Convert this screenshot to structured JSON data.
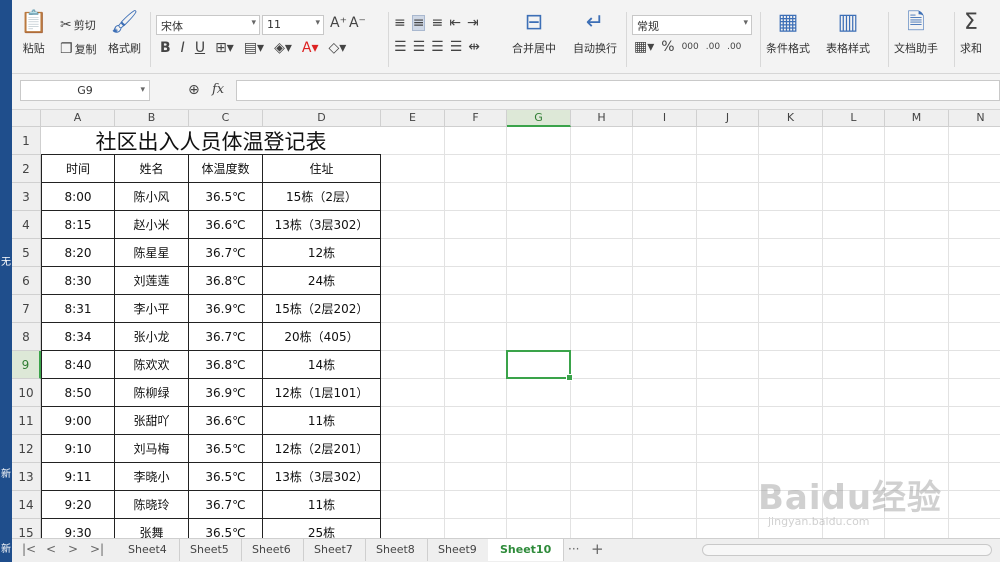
{
  "sidebar": {
    "text1": "无",
    "text2": "新",
    "text3": "新"
  },
  "ribbon": {
    "paste": "粘贴",
    "cut": "剪切",
    "copy": "复制",
    "format_painter": "格式刷",
    "font_name": "宋体",
    "font_size": "11",
    "bold": "B",
    "italic": "I",
    "underline": "U",
    "merge_center": "合并居中",
    "auto_wrap": "自动换行",
    "number_format": "常规",
    "percent": "%",
    "thousands": "000",
    "inc_decimal": ".00",
    "dec_decimal": ".00",
    "conditional_format": "条件格式",
    "table_style": "表格样式",
    "doc_assistant": "文档助手",
    "sum": "求和",
    "sum_symbol": "Σ"
  },
  "formula_bar": {
    "name_box": "G9",
    "fx": "fx",
    "formula": ""
  },
  "columns": [
    "A",
    "B",
    "C",
    "D",
    "E",
    "F",
    "G",
    "H",
    "I",
    "J",
    "K",
    "L",
    "M",
    "N"
  ],
  "rows": [
    "1",
    "2",
    "3",
    "4",
    "5",
    "6",
    "7",
    "8",
    "9",
    "10",
    "11",
    "12",
    "13",
    "14",
    "15"
  ],
  "table": {
    "title": "社区出入人员体温登记表",
    "headers": [
      "时间",
      "姓名",
      "体温度数",
      "住址"
    ],
    "rows": [
      [
        "8:00",
        "陈小风",
        "36.5℃",
        "15栋（2层）"
      ],
      [
        "8:15",
        "赵小米",
        "36.6℃",
        "13栋（3层302）"
      ],
      [
        "8:20",
        "陈星星",
        "36.7℃",
        "12栋"
      ],
      [
        "8:30",
        "刘莲莲",
        "36.8℃",
        "24栋"
      ],
      [
        "8:31",
        "李小平",
        "36.9℃",
        "15栋（2层202）"
      ],
      [
        "8:34",
        "张小龙",
        "36.7℃",
        "20栋（405）"
      ],
      [
        "8:40",
        "陈欢欢",
        "36.8℃",
        "14栋"
      ],
      [
        "8:50",
        "陈柳绿",
        "36.9℃",
        "12栋（1层101）"
      ],
      [
        "9:00",
        "张甜吖",
        "36.6℃",
        "11栋"
      ],
      [
        "9:10",
        "刘马梅",
        "36.5℃",
        "12栋（2层201）"
      ],
      [
        "9:11",
        "李晓小",
        "36.5℃",
        "13栋（3层302）"
      ],
      [
        "9:20",
        "陈晓玲",
        "36.7℃",
        "11栋"
      ],
      [
        "9:30",
        "张舞",
        "36.5℃",
        "25栋"
      ]
    ]
  },
  "selected": {
    "column": "G",
    "row": "9"
  },
  "sheets": [
    "Sheet4",
    "Sheet5",
    "Sheet6",
    "Sheet7",
    "Sheet8",
    "Sheet9",
    "Sheet10"
  ],
  "active_sheet": "Sheet10",
  "sheet_more": "···",
  "add_sheet": "+",
  "watermark": {
    "brand": "Baidu经验",
    "url": "jingyan.baidu.com"
  },
  "colors": {
    "accent": "#3aa34a",
    "sidebar": "#1f4e8c"
  }
}
